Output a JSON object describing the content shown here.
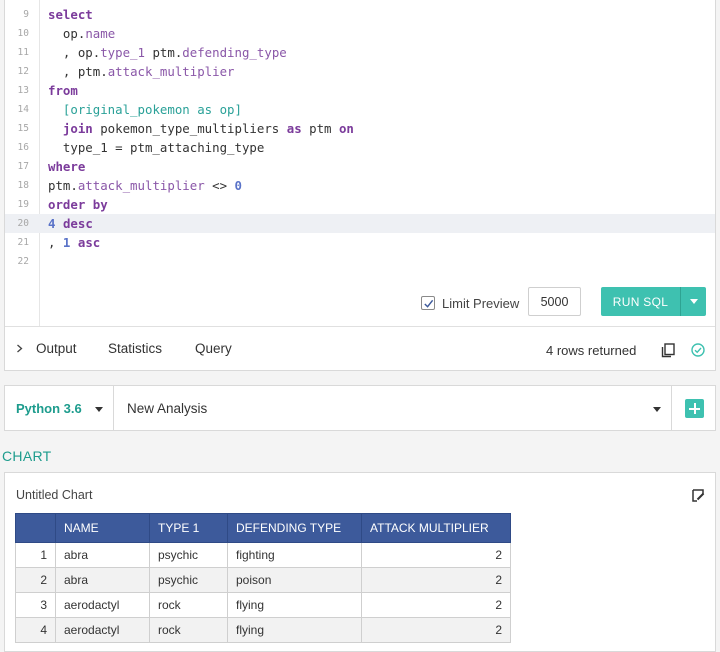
{
  "editor": {
    "lines": [
      {
        "num": "9",
        "segments": [
          {
            "t": "select",
            "c": "kw"
          }
        ]
      },
      {
        "num": "10",
        "segments": [
          {
            "t": "  op."
          },
          {
            "t": "name",
            "c": "pr"
          }
        ]
      },
      {
        "num": "11",
        "segments": [
          {
            "t": "  , op."
          },
          {
            "t": "type_1",
            "c": "pr"
          },
          {
            "t": " ptm."
          },
          {
            "t": "defending_type",
            "c": "pr"
          }
        ]
      },
      {
        "num": "12",
        "segments": [
          {
            "t": "  , ptm."
          },
          {
            "t": "attack_multiplier",
            "c": "pr"
          }
        ]
      },
      {
        "num": "13",
        "segments": [
          {
            "t": "from",
            "c": "kw"
          }
        ]
      },
      {
        "num": "14",
        "segments": [
          {
            "t": "  "
          },
          {
            "t": "[original_pokemon as op]",
            "c": "br"
          }
        ]
      },
      {
        "num": "15",
        "segments": [
          {
            "t": "  "
          },
          {
            "t": "join",
            "c": "kw"
          },
          {
            "t": " pokemon_type_multipliers "
          },
          {
            "t": "as",
            "c": "kw"
          },
          {
            "t": " ptm "
          },
          {
            "t": "on",
            "c": "kw"
          }
        ]
      },
      {
        "num": "16",
        "segments": [
          {
            "t": "  type_1 = ptm_attaching_type"
          }
        ]
      },
      {
        "num": "17",
        "segments": [
          {
            "t": "where",
            "c": "kw"
          }
        ]
      },
      {
        "num": "18",
        "segments": [
          {
            "t": "ptm."
          },
          {
            "t": "attack_multiplier",
            "c": "pr"
          },
          {
            "t": " <> "
          },
          {
            "t": "0",
            "c": "nm"
          }
        ]
      },
      {
        "num": "19",
        "segments": [
          {
            "t": "order by",
            "c": "kw"
          }
        ]
      },
      {
        "num": "20",
        "active": true,
        "segments": [
          {
            "t": "4",
            "c": "nm"
          },
          {
            "t": " "
          },
          {
            "t": "desc",
            "c": "kw"
          }
        ]
      },
      {
        "num": "21",
        "segments": [
          {
            "t": ", "
          },
          {
            "t": "1",
            "c": "nm"
          },
          {
            "t": " "
          },
          {
            "t": "asc",
            "c": "kw"
          }
        ]
      },
      {
        "num": "22",
        "segments": []
      }
    ]
  },
  "limit": {
    "label": "Limit Preview",
    "checked": true,
    "value": "5000"
  },
  "run": {
    "label": "RUN SQL"
  },
  "output_bar": {
    "tabs": [
      "Output",
      "Statistics",
      "Query"
    ],
    "rows_text": "4 rows returned"
  },
  "analysis": {
    "kernel": "Python 3.6",
    "name": "New Analysis"
  },
  "chart": {
    "heading": "CHART",
    "title": "Untitled Chart",
    "columns": [
      "NAME",
      "TYPE 1",
      "DEFENDING TYPE",
      "ATTACK MULTIPLIER"
    ],
    "rows": [
      [
        "1",
        "abra",
        "psychic",
        "fighting",
        "2"
      ],
      [
        "2",
        "abra",
        "psychic",
        "poison",
        "2"
      ],
      [
        "3",
        "aerodactyl",
        "rock",
        "flying",
        "2"
      ],
      [
        "4",
        "aerodactyl",
        "rock",
        "flying",
        "2"
      ]
    ]
  },
  "colors": {
    "accent": "#3ec1b0",
    "header": "#3d5a9b",
    "keyword": "#7b3b9b"
  }
}
